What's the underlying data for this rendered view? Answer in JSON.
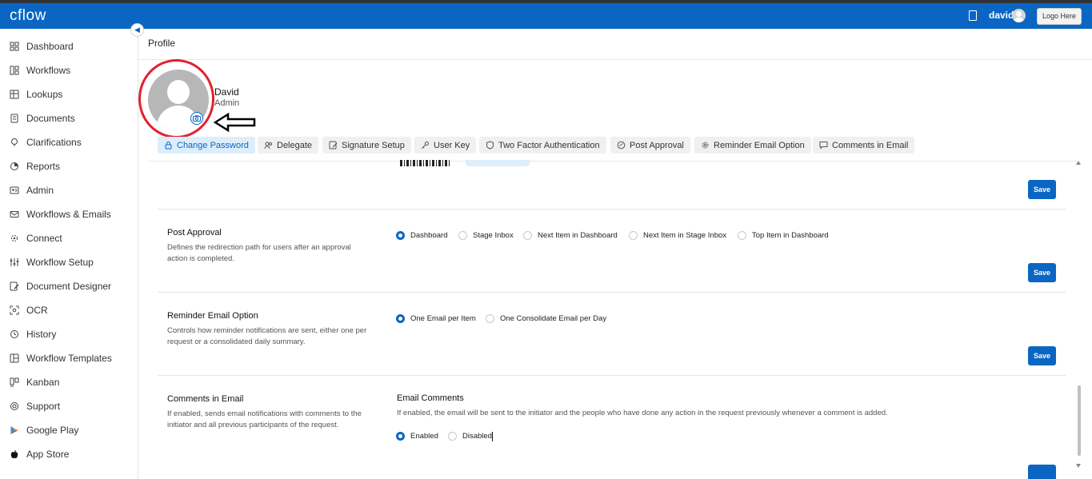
{
  "header": {
    "logo": "cflow",
    "username": "david",
    "logout_label": "Logo Here",
    "doc_icon": "document-icon",
    "avatar_icon": "user-avatar-icon"
  },
  "sidebar": {
    "collapse_icon": "chevron-left-icon",
    "items": [
      {
        "label": "Dashboard",
        "icon": "dashboard-icon"
      },
      {
        "label": "Workflows",
        "icon": "workflows-icon"
      },
      {
        "label": "Lookups",
        "icon": "table-icon"
      },
      {
        "label": "Documents",
        "icon": "document-icon"
      },
      {
        "label": "Clarifications",
        "icon": "bulb-icon"
      },
      {
        "label": "Reports",
        "icon": "pie-chart-icon"
      },
      {
        "label": "Admin",
        "icon": "admin-icon"
      },
      {
        "label": "Workflows & Emails",
        "icon": "mail-icon"
      },
      {
        "label": "Connect",
        "icon": "connect-icon"
      },
      {
        "label": "Workflow Setup",
        "icon": "sliders-icon"
      },
      {
        "label": "Document Designer",
        "icon": "edit-doc-icon"
      },
      {
        "label": "OCR",
        "icon": "scan-icon"
      },
      {
        "label": "History",
        "icon": "history-icon"
      },
      {
        "label": "Workflow Templates",
        "icon": "templates-icon"
      },
      {
        "label": "Kanban",
        "icon": "kanban-icon"
      },
      {
        "label": "Support",
        "icon": "support-icon"
      },
      {
        "label": "Google Play",
        "icon": "google-play-icon"
      },
      {
        "label": "App Store",
        "icon": "apple-icon"
      }
    ]
  },
  "page": {
    "title": "Profile"
  },
  "profile": {
    "name": "David",
    "role": "Admin",
    "camera_icon": "camera-icon"
  },
  "tabs": [
    {
      "label": "Change Password",
      "icon": "lock-icon",
      "active": true
    },
    {
      "label": "Delegate",
      "icon": "users-icon",
      "active": false
    },
    {
      "label": "Signature Setup",
      "icon": "pen-icon",
      "active": false
    },
    {
      "label": "User Key",
      "icon": "key-icon",
      "active": false
    },
    {
      "label": "Two Factor Authentication",
      "icon": "shield-icon",
      "active": false
    },
    {
      "label": "Post Approval",
      "icon": "check-circle-icon",
      "active": false
    },
    {
      "label": "Reminder Email Option",
      "icon": "gear-icon",
      "active": false
    },
    {
      "label": "Comments in Email",
      "icon": "comment-icon",
      "active": false
    }
  ],
  "sections": {
    "save_label": "Save",
    "post_approval": {
      "title": "Post Approval",
      "description": "Defines the redirection path for users after an approval action is completed.",
      "options": [
        {
          "label": "Dashboard",
          "selected": true
        },
        {
          "label": "Stage Inbox",
          "selected": false
        },
        {
          "label": "Next Item in Dashboard",
          "selected": false
        },
        {
          "label": "Next Item in Stage Inbox",
          "selected": false
        },
        {
          "label": "Top Item in Dashboard",
          "selected": false
        }
      ]
    },
    "reminder_email": {
      "title": "Reminder Email Option",
      "description": "Controls how reminder notifications are sent, either one per request or a consolidated daily summary.",
      "options": [
        {
          "label": "One Email per Item",
          "selected": true
        },
        {
          "label": "One Consolidate Email per Day",
          "selected": false
        }
      ]
    },
    "comments_email": {
      "title": "Comments in Email",
      "description": "If enabled, sends email notifications with comments to the initiator and all previous participants of the request.",
      "sub_title": "Email Comments",
      "sub_description": "If enabled, the email will be sent to the initiator and the people who have done any action in the request previously whenever a comment is added.",
      "options": [
        {
          "label": "Enabled",
          "selected": true
        },
        {
          "label": "Disabled",
          "selected": false
        }
      ]
    }
  },
  "colors": {
    "primary": "#0a66c2",
    "annotation_red": "#e2202b"
  }
}
